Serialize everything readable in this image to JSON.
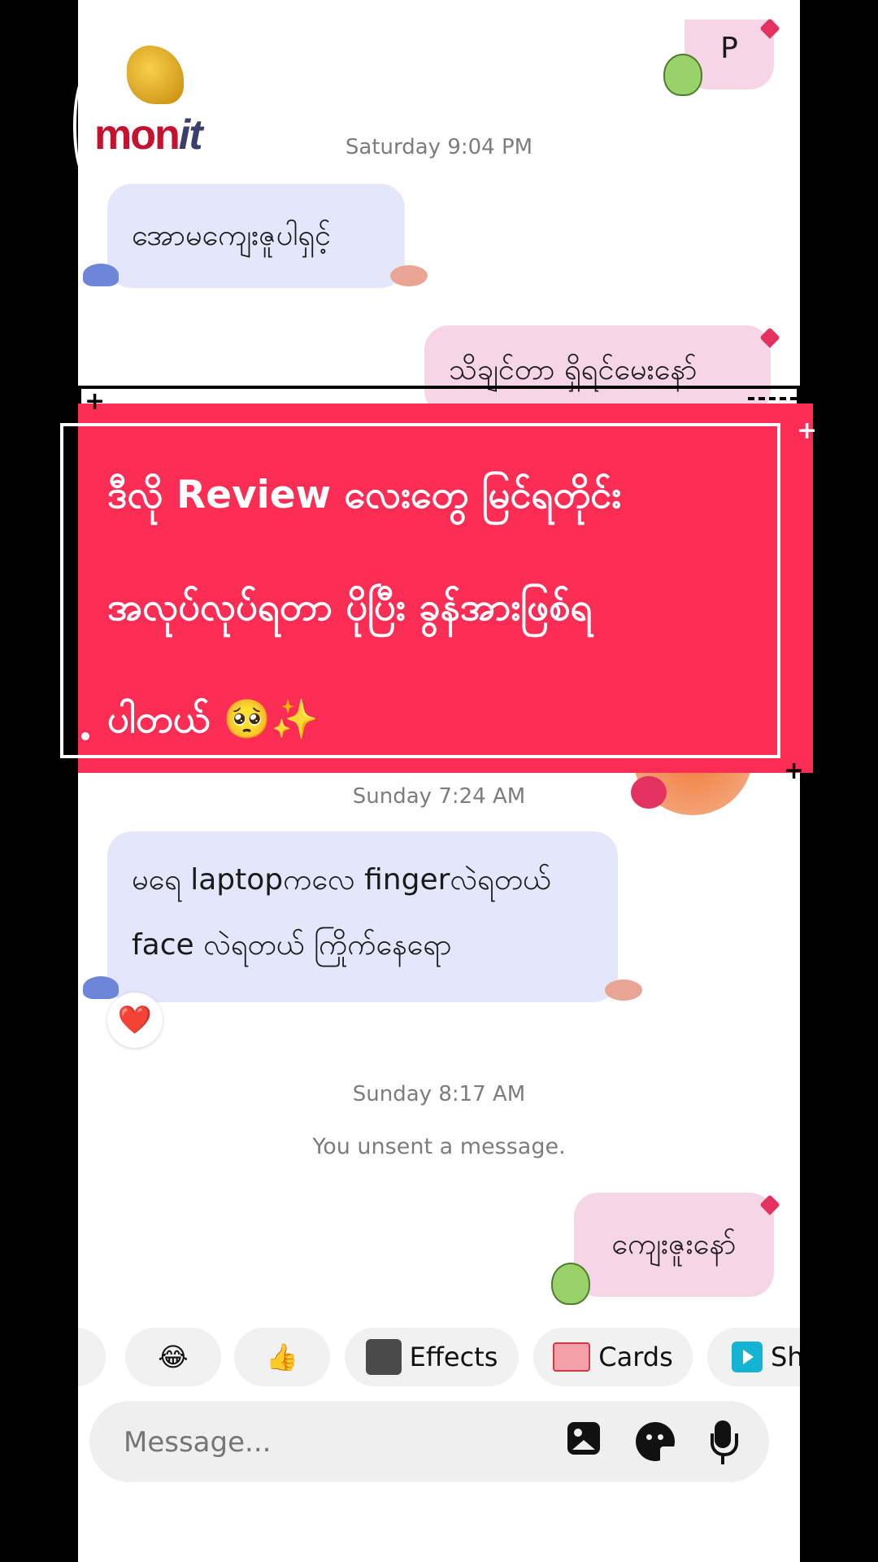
{
  "chat": {
    "top_bubble": "P",
    "ts1": "Saturday 9:04 PM",
    "msg1": "အောမကျေးဇူပါရှင့်",
    "msg2": "သိချင်တာ ရှိရင်မေးနော်",
    "ts2": "Sunday 7:24 AM",
    "msg3_line1": "မရေ laptopကလေ fingerလဲရတယ်",
    "msg3_line2": "face လဲရတယ် ကြိုက်နေရော",
    "reaction": "❤️",
    "ts3": "Sunday 8:17 AM",
    "unsent": "You unsent a message.",
    "msg4": "ကျေးဇူးနော်"
  },
  "logo": {
    "text": "mon",
    "suffix": "it"
  },
  "banner": {
    "line1": "ဒီလို Review လေးတွေ မြင်ရတိုင်း",
    "line2": "အလုပ်လုပ်ရတာ ပိုပြီး ခွန်အားဖြစ်ရ",
    "line3": "ပါတယ် 🥺✨"
  },
  "quick": {
    "laugh": "😂",
    "thumbs": "👍",
    "effects": "Effects",
    "cards": "Cards",
    "share": "Sh"
  },
  "composer": {
    "placeholder": "Message..."
  },
  "colors": {
    "banner": "#fc2d55",
    "incoming": "#e4e7fb",
    "outgoing": "#f6d5e6"
  }
}
